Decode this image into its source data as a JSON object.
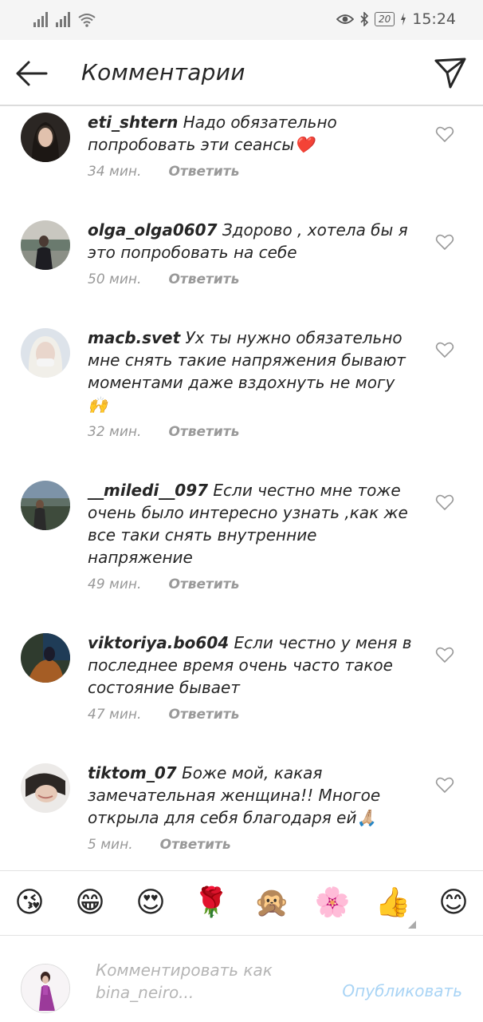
{
  "status_bar": {
    "battery": "20",
    "time": "15:24"
  },
  "header": {
    "title": "Комментарии"
  },
  "comments": [
    {
      "username": "eti_shtern",
      "text": "Надо обязательно попробовать эти сеансы❤️",
      "time": "34 мин.",
      "reply_label": "Ответить"
    },
    {
      "username": "olga_olga0607",
      "text": "Здорово , хотела бы я это попробовать на себе",
      "time": "50 мин.",
      "reply_label": "Ответить"
    },
    {
      "username": "macb.svet",
      "text": "Ух ты нужно обязательно мне снять такие напряжения бывают моментами даже вздохнуть не могу 🙌",
      "time": "32 мин.",
      "reply_label": "Ответить"
    },
    {
      "username": "__miledi__097",
      "text": "Если честно мне тоже очень было  интересно узнать ,как же все таки снять внутренние напряжение",
      "time": "49 мин.",
      "reply_label": "Ответить"
    },
    {
      "username": "viktoriya.bo604",
      "text": "Если честно у меня в последнее время очень часто такое состояние бывает",
      "time": "47 мин.",
      "reply_label": "Ответить"
    },
    {
      "username": "tiktom_07",
      "text": "Боже мой, какая замечательная женщина!! Многое открыла для себя благодаря ей🙏🏼",
      "time": "5 мин.",
      "reply_label": "Ответить"
    }
  ],
  "emoji_bar": [
    "😘",
    "😁",
    "😍",
    "🌹",
    "🙊",
    "🌸",
    "👍",
    "😊"
  ],
  "composer": {
    "placeholder": "Комментировать как bina_neiro...",
    "post_label": "Опубликовать"
  },
  "colors": {
    "accent_disabled": "#a9d4f5",
    "meta_text": "#999999",
    "divider": "#dcdcdc"
  }
}
